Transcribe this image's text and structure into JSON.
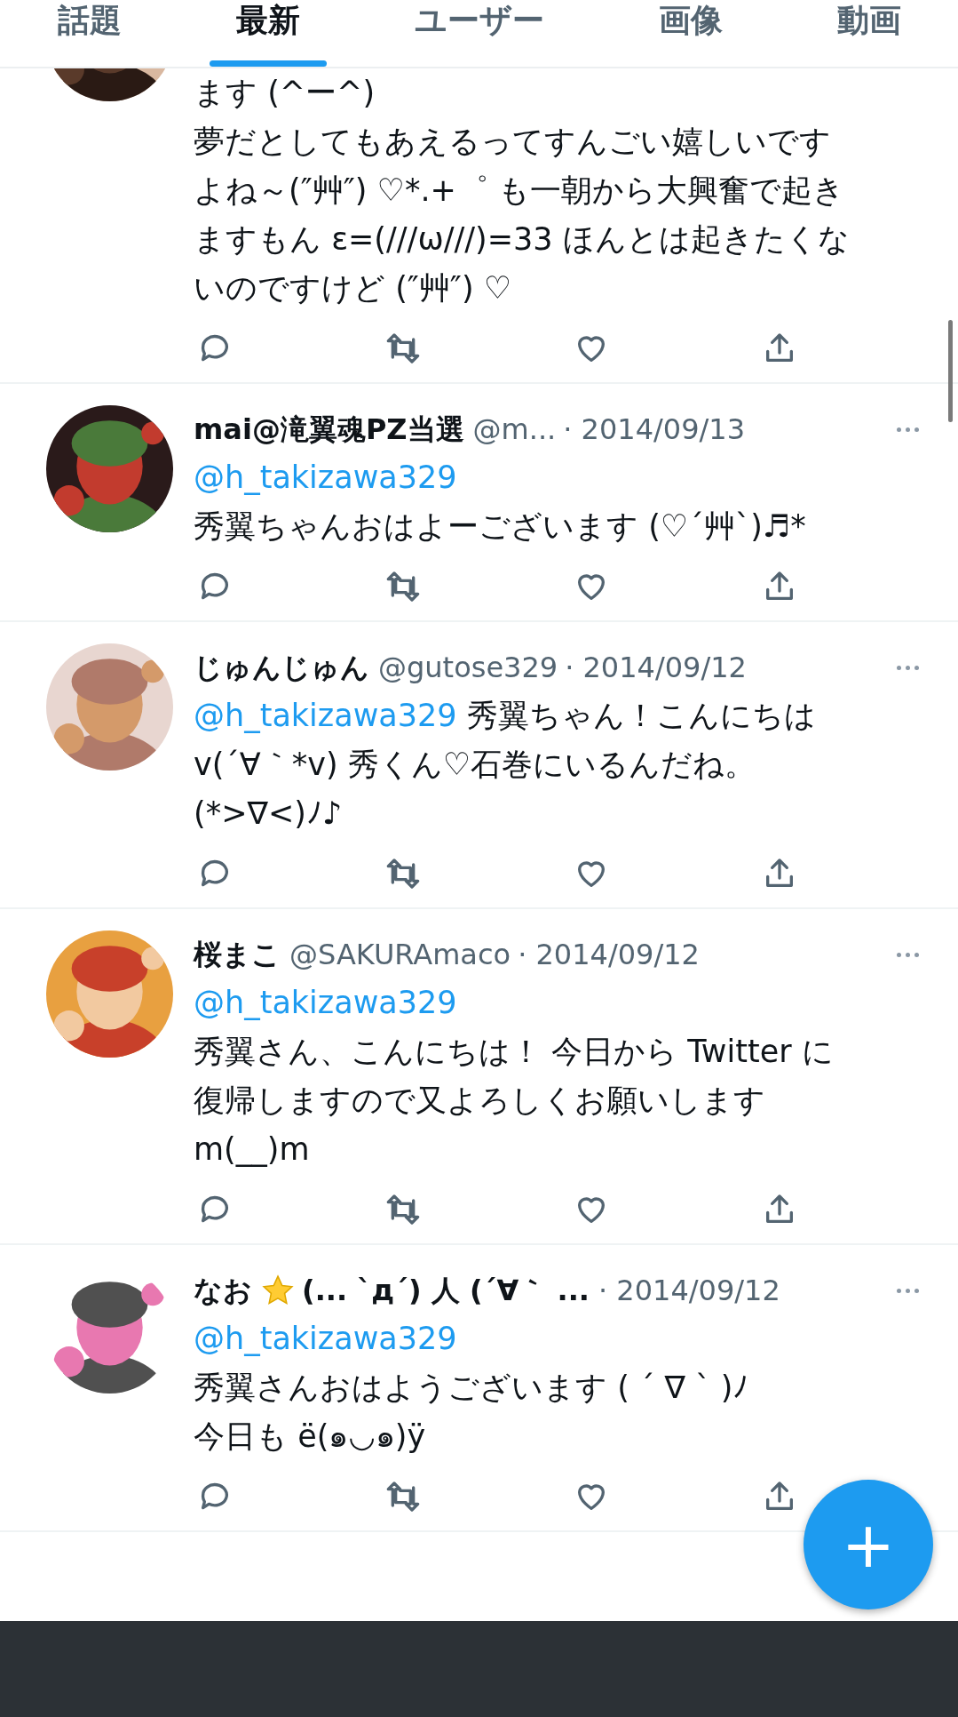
{
  "tabs": [
    {
      "label": "話題",
      "selected": false
    },
    {
      "label": "最新",
      "selected": true
    },
    {
      "label": "ユーザー",
      "selected": false
    },
    {
      "label": "画像",
      "selected": false
    },
    {
      "label": "動画",
      "selected": false
    }
  ],
  "tweets": [
    {
      "avatar": {
        "kind": "picture"
      },
      "lines": [
        "ます (^ー^)",
        "夢だとしてもあえるってすんごい嬉しいです",
        "よね～(″艸″) ♡*.+゜ も一朝から大興奮で起き",
        "ますもん ε=(///ω///)=33 ほんとは起きたくな",
        "いのですけど (″艸″) ♡"
      ]
    },
    {
      "avatar": {
        "kind": "picture"
      },
      "name": "mai@滝翼魂PZ当選",
      "star_badge": false,
      "handle": "@m...",
      "date": "· 2014/09/13",
      "mention": "@h_takizawa329",
      "lines": [
        "秀翼ちゃんおはよーございます (♡´艸`)♬*"
      ]
    },
    {
      "avatar": {
        "kind": "picture"
      },
      "name": "じゅんじゅん",
      "star_badge": false,
      "handle": "@gutose329",
      "date": "· 2014/09/12",
      "inline_mention": "@h_takizawa329",
      "lines": [
        "秀翼ちゃん！こんにちは",
        "v(´∀｀*v) 秀くん♡石巻にいるんだね。",
        "(*>∇<)ﾉ♪"
      ]
    },
    {
      "avatar": {
        "kind": "picture"
      },
      "name": "桜まこ",
      "star_badge": false,
      "handle": "@SAKURAmaco",
      "date": "· 2014/09/12",
      "mention": "@h_takizawa329",
      "lines": [
        "秀翼さん、こんにちは！ 今日から Twitter に",
        "復帰しますので又よろしくお願いします",
        "m(__)m"
      ]
    },
    {
      "avatar": {
        "kind": "picture"
      },
      "name": "なお",
      "star_badge": true,
      "name_suffix": "(... `д´) 人 (´∀｀ ...",
      "date": "· 2014/09/12",
      "mention": "@h_takizawa329",
      "lines": [
        "秀翼さんおはようございます ( ´ ∇ ` )ﾉ",
        "今日も ë(๑◡๑)ÿ"
      ]
    }
  ],
  "fab": {
    "label": "+"
  }
}
